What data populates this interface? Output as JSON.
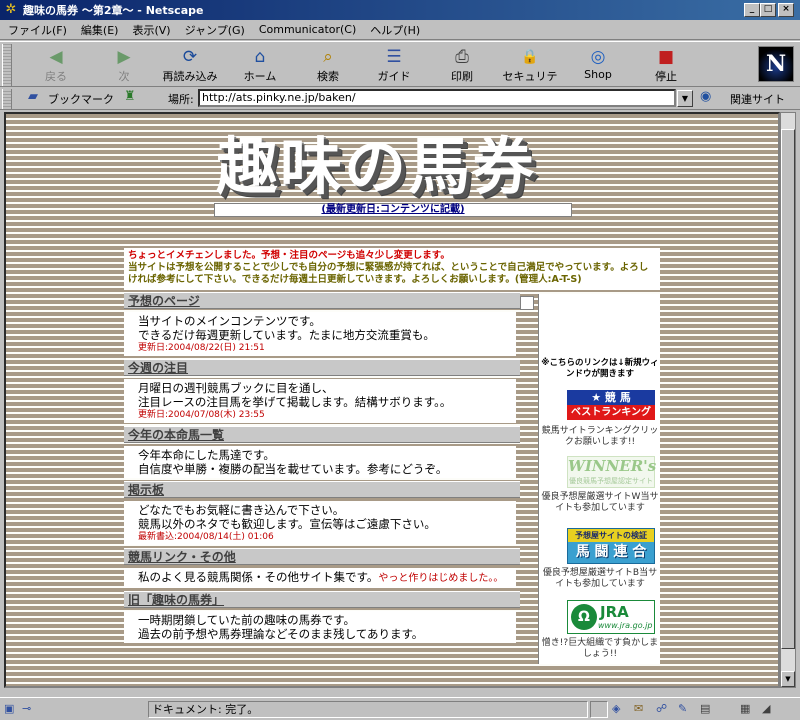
{
  "window": {
    "title": "趣味の馬券 ～第2章～ - Netscape",
    "min": "_",
    "max": "□",
    "close": "×"
  },
  "menu": [
    "ファイル(F)",
    "編集(E)",
    "表示(V)",
    "ジャンプ(G)",
    "Communicator(C)",
    "ヘルプ(H)"
  ],
  "toolbar": [
    {
      "label": "戻る",
      "icon": "back-arrow-icon",
      "glyph": "◀",
      "disabled": true
    },
    {
      "label": "次",
      "icon": "forward-arrow-icon",
      "glyph": "▶",
      "disabled": true
    },
    {
      "label": "再読み込み",
      "icon": "reload-icon",
      "glyph": "⟳",
      "disabled": false
    },
    {
      "label": "ホーム",
      "icon": "home-icon",
      "glyph": "⌂",
      "disabled": false
    },
    {
      "label": "検索",
      "icon": "search-icon",
      "glyph": "⌕",
      "disabled": false
    },
    {
      "label": "ガイド",
      "icon": "guide-icon",
      "glyph": "☰",
      "disabled": false
    },
    {
      "label": "印刷",
      "icon": "print-icon",
      "glyph": "⎙",
      "disabled": false
    },
    {
      "label": "セキュリティ",
      "icon": "security-lock-icon",
      "glyph": "🔒",
      "disabled": false
    },
    {
      "label": "Shop",
      "icon": "shop-icon",
      "glyph": "◎",
      "disabled": false
    },
    {
      "label": "停止",
      "icon": "stop-icon",
      "glyph": "■",
      "disabled": false
    }
  ],
  "location": {
    "bookmarks": "ブックマーク",
    "label": "場所:",
    "url": "http://ats.pinky.ne.jp/baken/",
    "related": "関連サイト"
  },
  "page": {
    "title": "趣味の馬券",
    "update": "(最新更新日:コンテンツに記載)",
    "notice_red": "ちょっとイメチェンしました。予想・注目のページも追々少し変更します。",
    "notice_ol": "当サイトは予想を公開することで少しでも自分の予想に緊張感が持てれば、ということで自己満足でやっています。よろしければ参考にして下さい。できるだけ毎週土日更新していきます。よろしくお願いします。(管理人:A-T-S)",
    "sections": [
      {
        "title": "予想のページ",
        "lines": [
          "当サイトのメインコンテンツです。",
          "できるだけ毎週更新しています。たまに地方交流重賞も。"
        ],
        "date": "更新日:2004/08/22(日) 21:51"
      },
      {
        "title": "今週の注目",
        "lines": [
          "月曜日の週刊競馬ブックに目を通し、",
          "注目レースの注目馬を挙げて掲載します。結構サボります。。"
        ],
        "date": "更新日:2004/07/08(木) 23:55"
      },
      {
        "title": "今年の本命馬一覧",
        "lines": [
          "今年本命にした馬達です。",
          "自信度や単勝・複勝の配当を載せています。参考にどうぞ。"
        ],
        "date": ""
      },
      {
        "title": "掲示板",
        "lines": [
          "どなたでもお気軽に書き込んで下さい。",
          "競馬以外のネタでも歓迎します。宣伝等はご遠慮下さい。"
        ],
        "date": "最新書込:2004/08/14(土) 01:06"
      },
      {
        "title": "競馬リンク・その他",
        "lines": [
          "私のよく見る競馬関係・その他サイト集です。"
        ],
        "extra": "やっと作りはじめました。。",
        "date": ""
      },
      {
        "title": "旧「趣味の馬券」",
        "lines": [
          "一時期閉鎖していた前の趣味の馬券です。",
          "過去の前予想や馬券理論などそのまま残してあります。"
        ],
        "date": ""
      }
    ],
    "sidebar": {
      "note": "※こちらのリンクは↓新規ウィンドウが開きます",
      "b1_top": "★ 競 馬",
      "b1_bottom": "ベストランキング",
      "cap1": "競馬サイトランキングクリックお願いします!!",
      "b2_top": "WINNER's",
      "b2_bottom": "優良競馬予想屋認定サイト",
      "cap2": "優良予想屋厳選サイトW当サイトも参加しています",
      "b3_top": "予想屋サイトの検証",
      "b3_bottom": "馬 闘 連 合",
      "cap3": "優良予想屋厳選サイトB当サイトも参加しています",
      "b4_top": "JRA",
      "b4_bottom": "www.jra.go.jp",
      "cap4": "憎き!?巨大組織です負かしましょう!!"
    }
  },
  "status": {
    "text": "ドキュメント: 完了。"
  }
}
